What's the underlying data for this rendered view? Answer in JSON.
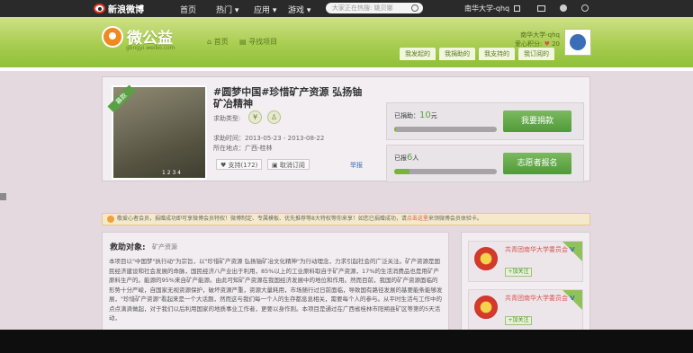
{
  "topbar": {
    "logo": "新浪微博",
    "nav": [
      "首页",
      "热门 ▾",
      "应用 ▾",
      "游戏 ▾"
    ],
    "search_placeholder": "大家正在热搜: 姚贝娜",
    "user": "南华大学-qhq"
  },
  "banner": {
    "brand": "微公益",
    "brand_sub": "gongyi.weibo.com",
    "nav": [
      "首页",
      "寻找项目"
    ],
    "user_name": "南华大学-qhq",
    "points_label": "爱心积分:",
    "points": "20",
    "tabs": [
      "我发起的",
      "我捐助的",
      "我支持的",
      "我订阅的"
    ]
  },
  "project": {
    "ribbon": "募款",
    "thumb_nums": "1 2 3 4",
    "title": "#圆梦中国#珍惜矿产资源 弘扬铀矿冶精神",
    "type_label": "求助类型:",
    "time_label": "求助时间：",
    "time_value": "2013-05-23 - 2013-08-22",
    "location_label": "所在地点：",
    "location_value": "广西-桂林",
    "support_btn": "支持(172)",
    "subscribe_btn": "取消订阅",
    "report": "举报",
    "donate_label": "已捐助：",
    "donate_amount": "10",
    "donate_unit": "元",
    "donate_progress": 0.02,
    "donate_btn": "我要捐款",
    "volunteer_label": "已报",
    "volunteer_count": "6",
    "volunteer_unit": "人",
    "volunteer_progress": 0.15,
    "volunteer_btn": "志愿者报名"
  },
  "notice": {
    "text": "敬爱心者会员，捐赠成功即可享微博会员特权！微博制定、专属模板、优先推荐等8大特权等你来享！如您已捐赠成功，请",
    "link": "点击这里",
    "tail": "来领微博会员体验卡。"
  },
  "objective": {
    "heading": "救助对象:",
    "sub": "矿产资源",
    "body": "本项目以\"中国梦\"执行动\"为宗旨，以\"珍惜矿产资源 弘扬铀矿冶文化精神\"为行动理念，力求引起社会的广泛关注。矿产资源是国民经济建设和社会发展的命脉，国民经济八产业出于利用，85%以上的工业原料取自于矿产资源，17%的生活消费品也是用矿产原料生产的。能源的95%来自矿产能源。由此可知矿产资源在我国经济发展中的地位和作用。然而目前，我国的矿产资源面临的形势十分严峻，自国家无视资源保护，破坏资源严重，资源大量耗用，市场随行过日前面临，导致国有路径发展的基要能条能够发展，\"珍惜矿产资源\"看起来是一个大话题，然而这与我们每一个人的生存都息息相关，需要每个人的参与。从平时生活与工作中的点点滴滴做起，对于我们以后利用国家的地质事业工作者，更要以身作则。本项目是通过在广西省桂林市阳朔县矿区等第的5天活动，"
  },
  "sidebar": {
    "orgs": [
      {
        "name": "共青团南华大学委员会",
        "follow": "+加关注"
      },
      {
        "name": "共青团南华大学委员会",
        "follow": "+加关注"
      }
    ]
  }
}
